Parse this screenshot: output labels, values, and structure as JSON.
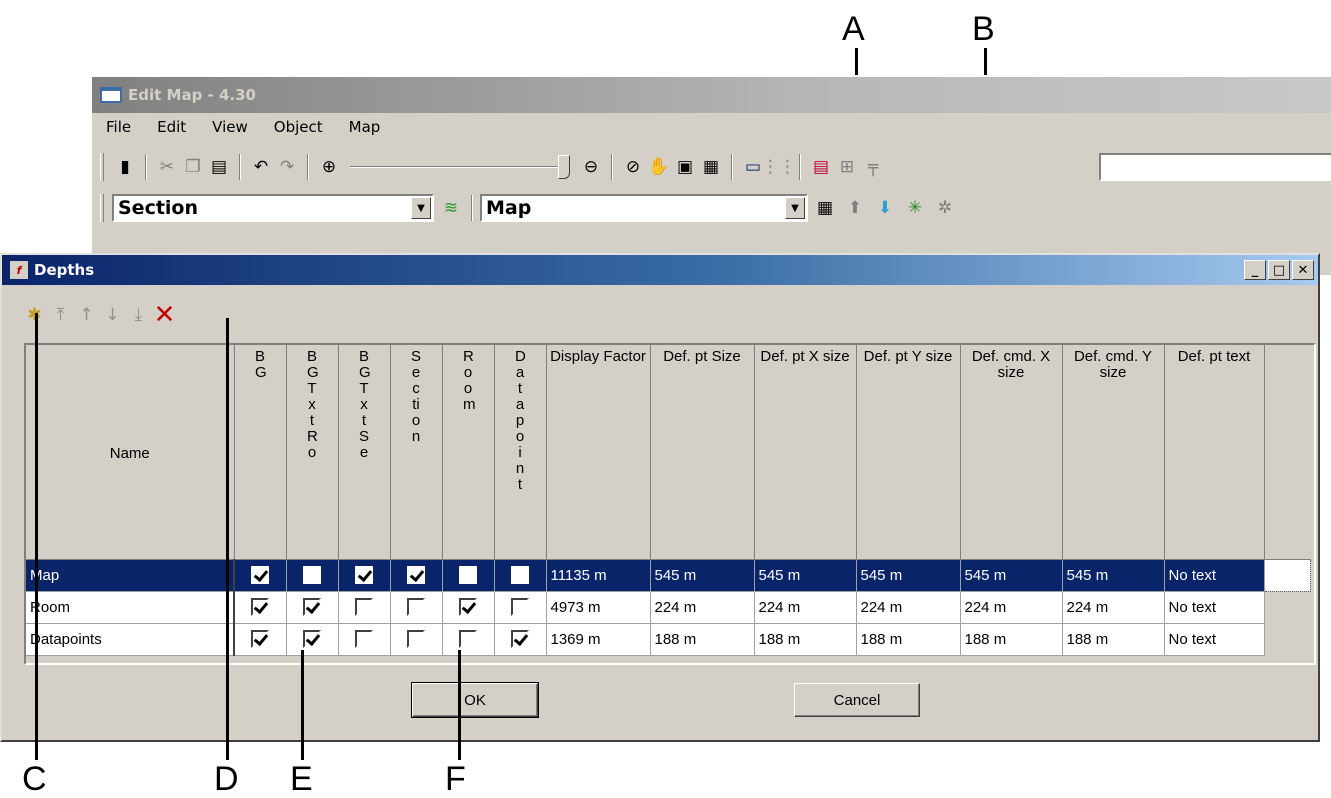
{
  "callouts": {
    "a": "A",
    "b": "B",
    "c": "C",
    "d": "D",
    "e": "E",
    "f": "F"
  },
  "edit_map": {
    "title": "Edit Map - 4.30",
    "menu": [
      "File",
      "Edit",
      "View",
      "Object",
      "Map"
    ],
    "section_combo": "Section",
    "map_combo": "Map",
    "search_value": ""
  },
  "dialog": {
    "title": "Depths",
    "ok_label": "OK",
    "cancel_label": "Cancel",
    "columns": [
      {
        "key": "name",
        "label": "Name"
      },
      {
        "key": "bg",
        "label": "BG"
      },
      {
        "key": "bg_txt_ro",
        "label": "BG Txt Ro"
      },
      {
        "key": "bg_txt_se",
        "label": "BG Txt Se"
      },
      {
        "key": "section",
        "label": "Section"
      },
      {
        "key": "room",
        "label": "Room"
      },
      {
        "key": "datapoint",
        "label": "Datapoint"
      },
      {
        "key": "display_factor",
        "label": "Display Factor"
      },
      {
        "key": "pt_size",
        "label": "Def. pt Size"
      },
      {
        "key": "pt_x",
        "label": "Def. pt X size"
      },
      {
        "key": "pt_y",
        "label": "Def. pt Y size"
      },
      {
        "key": "cmd_x",
        "label": "Def. cmd. X size"
      },
      {
        "key": "cmd_y",
        "label": "Def. cmd. Y size"
      },
      {
        "key": "pt_text",
        "label": "Def. pt text"
      }
    ],
    "rows": [
      {
        "name": "Map",
        "selected": true,
        "checks": [
          true,
          false,
          true,
          true,
          false,
          false
        ],
        "display_factor": "11135 m",
        "pt_size": "545 m",
        "pt_x": "545 m",
        "pt_y": "545 m",
        "cmd_x": "545 m",
        "cmd_y": "545 m",
        "pt_text": "No text"
      },
      {
        "name": "Room",
        "selected": false,
        "checks": [
          true,
          true,
          false,
          false,
          true,
          false
        ],
        "display_factor": "4973 m",
        "pt_size": "224 m",
        "pt_x": "224 m",
        "pt_y": "224 m",
        "cmd_x": "224 m",
        "cmd_y": "224 m",
        "pt_text": "No text"
      },
      {
        "name": "Datapoints",
        "selected": false,
        "checks": [
          true,
          true,
          false,
          false,
          false,
          true
        ],
        "display_factor": "1369 m",
        "pt_size": "188 m",
        "pt_x": "188 m",
        "pt_y": "188 m",
        "cmd_x": "188 m",
        "cmd_y": "188 m",
        "pt_text": "No text"
      }
    ]
  }
}
